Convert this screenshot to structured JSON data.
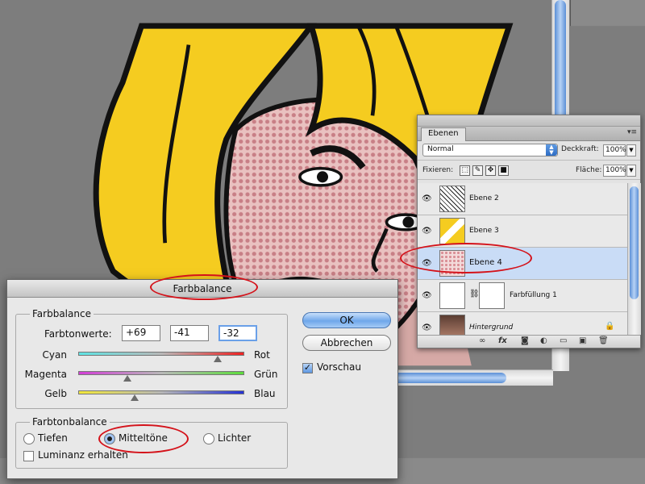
{
  "layers_panel": {
    "tab": "Ebenen",
    "blend_mode": "Normal",
    "opacity_label": "Deckkraft:",
    "opacity_value": "100%",
    "lock_label": "Fixieren:",
    "fill_label": "Fläche:",
    "fill_value": "100%",
    "layers": [
      {
        "name": "Ebene 2",
        "selected": false
      },
      {
        "name": "Ebene 3",
        "selected": false
      },
      {
        "name": "Ebene 4",
        "selected": true
      },
      {
        "name": "Farbfüllung 1",
        "selected": false
      },
      {
        "name": "Hintergrund",
        "selected": false
      }
    ]
  },
  "dialog": {
    "title": "Farbbalance",
    "group1_title": "Farbbalance",
    "tone_values_label": "Farbtonwerte:",
    "values": [
      "+69",
      "-41",
      "-32"
    ],
    "sliders": [
      {
        "left": "Cyan",
        "right": "Rot",
        "value": 69
      },
      {
        "left": "Magenta",
        "right": "Grün",
        "value": -41
      },
      {
        "left": "Gelb",
        "right": "Blau",
        "value": -32
      }
    ],
    "group2_title": "Farbtonbalance",
    "tones": [
      "Tiefen",
      "Mitteltöne",
      "Lichter"
    ],
    "selected_tone": "Mitteltöne",
    "luminance_label": "Luminanz erhalten",
    "luminance_checked": false,
    "ok_label": "OK",
    "cancel_label": "Abbrechen",
    "preview_label": "Vorschau",
    "preview_checked": true
  },
  "colors": {
    "accent": "#6aa0e8",
    "annotation": "#d4121a",
    "hair": "#f5cc20"
  }
}
